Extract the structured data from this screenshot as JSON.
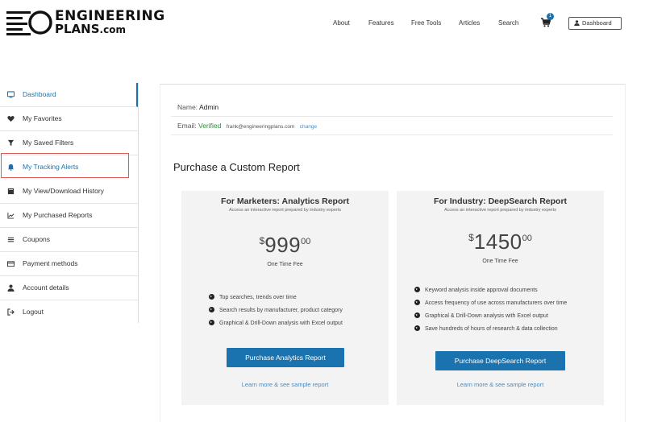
{
  "brand": {
    "line1": "ENGINEERING",
    "line2": "PLANS",
    "line2_suffix": ".com"
  },
  "nav": {
    "items": [
      "About",
      "Features",
      "Free Tools",
      "Articles",
      "Search"
    ],
    "cart_icon": "shopping-cart-icon",
    "cart_count": "1",
    "dashboard_label": "Dashboard"
  },
  "sidebar": {
    "items": [
      {
        "label": "Dashboard",
        "icon": "dashboard-icon"
      },
      {
        "label": "My Favorites",
        "icon": "heart-icon"
      },
      {
        "label": "My Saved Filters",
        "icon": "filter-icon"
      },
      {
        "label": "My Tracking Alerts",
        "icon": "bell-icon"
      },
      {
        "label": "My View/Download History",
        "icon": "book-icon"
      },
      {
        "label": "My Purchased Reports",
        "icon": "chart-icon"
      },
      {
        "label": "Coupons",
        "icon": "list-icon"
      },
      {
        "label": "Payment methods",
        "icon": "card-icon"
      },
      {
        "label": "Account details",
        "icon": "user-icon"
      },
      {
        "label": "Logout",
        "icon": "logout-icon"
      }
    ],
    "colors": {
      "active": "#1a73ae",
      "highlight_border": "#e05a5a"
    }
  },
  "account": {
    "name_label": "Name:",
    "name_value": "Admin",
    "email_label": "Email:",
    "email_status": "Verified",
    "email_address": "frank@engineeringplans.com",
    "change_label": "change"
  },
  "purchase": {
    "title": "Purchase a Custom Report",
    "cards": [
      {
        "title": "For Marketers: Analytics Report",
        "subtitle": "Access an interactive report prepared by industry experts",
        "currency": "$",
        "price": "999",
        "cents": "00",
        "fee_label": "One Time Fee",
        "features": [
          "Top searches, trends over time",
          "Search results by manufacturer, product category",
          "Graphical & Drill-Down analysis with Excel output"
        ],
        "button": "Purchase Analytics Report",
        "learn_more": "Learn more & see sample report"
      },
      {
        "title": "For Industry: DeepSearch Report",
        "subtitle": "Access an interactive report prepared by industry experts",
        "currency": "$",
        "price": "1450",
        "cents": "00",
        "fee_label": "One Time Fee",
        "features": [
          "Keyword analysis inside approval documents",
          "Access frequency of use across manufacturers over time",
          "Graphical & Drill-Down analysis with Excel output",
          "Save hundreds of hours of research & data collection"
        ],
        "button": "Purchase DeepSearch Report",
        "learn_more": "Learn more & see sample report"
      }
    ],
    "colors": {
      "button": "#1a73ae",
      "link": "#4a8bbf",
      "verified": "#2e8b3a"
    }
  }
}
